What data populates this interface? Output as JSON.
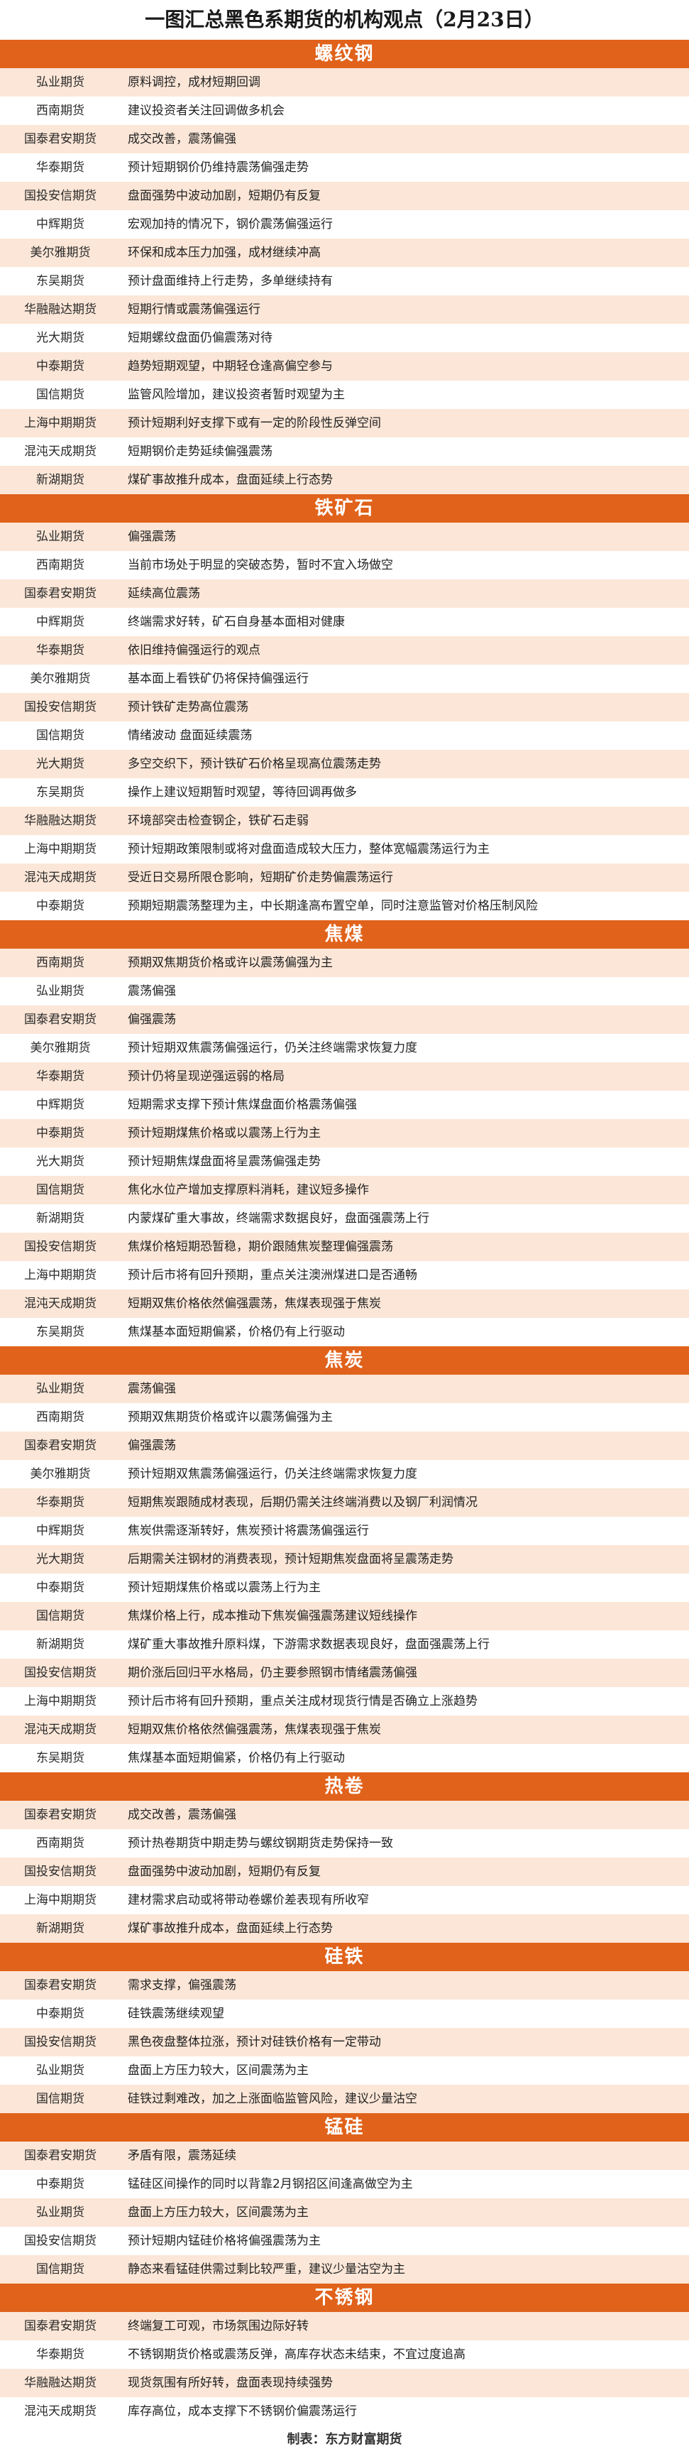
{
  "title": "一图汇总黑色系期货的机构观点（2月23日）",
  "footer": "制表：东方财富期货",
  "sections": [
    {
      "name": "螺纹钢",
      "rows": [
        [
          "弘业期货",
          "原料调控，成材短期回调"
        ],
        [
          "西南期货",
          "建议投资者关注回调做多机会"
        ],
        [
          "国泰君安期货",
          "成交改善，震荡偏强"
        ],
        [
          "华泰期货",
          "预计短期钢价仍维持震荡偏强走势"
        ],
        [
          "国投安信期货",
          "盘面强势中波动加剧，短期仍有反复"
        ],
        [
          "中辉期货",
          "宏观加持的情况下，钢价震荡偏强运行"
        ],
        [
          "美尔雅期货",
          "环保和成本压力加强，成材继续冲高"
        ],
        [
          "东吴期货",
          "预计盘面维持上行走势，多单继续持有"
        ],
        [
          "华融融达期货",
          "短期行情或震荡偏强运行"
        ],
        [
          "光大期货",
          "短期螺纹盘面仍偏震荡对待"
        ],
        [
          "中泰期货",
          "趋势短期观望，中期轻仓逢高偏空参与"
        ],
        [
          "国信期货",
          "监管风险增加，建议投资者暂时观望为主"
        ],
        [
          "上海中期期货",
          "预计短期利好支撑下或有一定的阶段性反弹空间"
        ],
        [
          "混沌天成期货",
          "短期钢价走势延续偏强震荡"
        ],
        [
          "新湖期货",
          "煤矿事故推升成本，盘面延续上行态势"
        ]
      ]
    },
    {
      "name": "铁矿石",
      "rows": [
        [
          "弘业期货",
          "偏强震荡"
        ],
        [
          "西南期货",
          "当前市场处于明显的突破态势，暂时不宜入场做空"
        ],
        [
          "国泰君安期货",
          "延续高位震荡"
        ],
        [
          "中辉期货",
          "终端需求好转，矿石自身基本面相对健康"
        ],
        [
          "华泰期货",
          "依旧维持偏强运行的观点"
        ],
        [
          "美尔雅期货",
          "基本面上看铁矿仍将保持偏强运行"
        ],
        [
          "国投安信期货",
          "预计铁矿走势高位震荡"
        ],
        [
          "国信期货",
          "情绪波动 盘面延续震荡"
        ],
        [
          "光大期货",
          "多空交织下，预计铁矿石价格呈现高位震荡走势"
        ],
        [
          "东吴期货",
          "操作上建议短期暂时观望，等待回调再做多"
        ],
        [
          "华融融达期货",
          "环境部突击检查钢企，铁矿石走弱"
        ],
        [
          "上海中期期货",
          "预计短期政策限制或将对盘面造成较大压力，整体宽幅震荡运行为主"
        ],
        [
          "混沌天成期货",
          "受近日交易所限仓影响，短期矿价走势偏震荡运行"
        ],
        [
          "中泰期货",
          "预期短期震荡整理为主，中长期逢高布置空单，同时注意监管对价格压制风险"
        ]
      ]
    },
    {
      "name": "焦煤",
      "rows": [
        [
          "西南期货",
          "预期双焦期货价格或许以震荡偏强为主"
        ],
        [
          "弘业期货",
          "震荡偏强"
        ],
        [
          "国泰君安期货",
          "偏强震荡"
        ],
        [
          "美尔雅期货",
          "预计短期双焦震荡偏强运行，仍关注终端需求恢复力度"
        ],
        [
          "华泰期货",
          "预计仍将呈现逆强运弱的格局"
        ],
        [
          "中辉期货",
          "短期需求支撑下预计焦煤盘面价格震荡偏强"
        ],
        [
          "中泰期货",
          "预计短期煤焦价格或以震荡上行为主"
        ],
        [
          "光大期货",
          "预计短期焦煤盘面将呈震荡偏强走势"
        ],
        [
          "国信期货",
          "焦化水位产增加支撑原料消耗，建议短多操作"
        ],
        [
          "新湖期货",
          "内蒙煤矿重大事故，终端需求数据良好，盘面强震荡上行"
        ],
        [
          "国投安信期货",
          "焦煤价格短期恐暂稳，期价跟随焦炭整理偏强震荡"
        ],
        [
          "上海中期期货",
          "预计后市将有回升预期，重点关注澳洲煤进口是否通畅"
        ],
        [
          "混沌天成期货",
          "短期双焦价格依然偏强震荡，焦煤表现强于焦炭"
        ],
        [
          "东吴期货",
          "焦煤基本面短期偏紧，价格仍有上行驱动"
        ]
      ]
    },
    {
      "name": "焦炭",
      "rows": [
        [
          "弘业期货",
          "震荡偏强"
        ],
        [
          "西南期货",
          "预期双焦期货价格或许以震荡偏强为主"
        ],
        [
          "国泰君安期货",
          "偏强震荡"
        ],
        [
          "美尔雅期货",
          "预计短期双焦震荡偏强运行，仍关注终端需求恢复力度"
        ],
        [
          "华泰期货",
          "短期焦炭跟随成材表现，后期仍需关注终端消费以及钢厂利润情况"
        ],
        [
          "中辉期货",
          "焦炭供需逐渐转好，焦炭预计将震荡偏强运行"
        ],
        [
          "光大期货",
          "后期需关注钢材的消费表现，预计短期焦炭盘面将呈震荡走势"
        ],
        [
          "中泰期货",
          "预计短期煤焦价格或以震荡上行为主"
        ],
        [
          "国信期货",
          "焦煤价格上行，成本推动下焦炭偏强震荡建议短线操作"
        ],
        [
          "新湖期货",
          "煤矿重大事故推升原料煤，下游需求数据表现良好，盘面强震荡上行"
        ],
        [
          "国投安信期货",
          "期价涨后回归平水格局，仍主要参照钢市情绪震荡偏强"
        ],
        [
          "上海中期期货",
          "预计后市将有回升预期，重点关注成材现货行情是否确立上涨趋势"
        ],
        [
          "混沌天成期货",
          "短期双焦价格依然偏强震荡，焦煤表现强于焦炭"
        ],
        [
          "东吴期货",
          "焦煤基本面短期偏紧，价格仍有上行驱动"
        ]
      ]
    },
    {
      "name": "热卷",
      "rows": [
        [
          "国泰君安期货",
          "成交改善，震荡偏强"
        ],
        [
          "西南期货",
          "预计热卷期货中期走势与螺纹钢期货走势保持一致"
        ],
        [
          "国投安信期货",
          "盘面强势中波动加剧，短期仍有反复"
        ],
        [
          "上海中期期货",
          "建材需求启动或将带动卷螺价差表现有所收窄"
        ],
        [
          "新湖期货",
          "煤矿事故推升成本，盘面延续上行态势"
        ]
      ]
    },
    {
      "name": "硅铁",
      "rows": [
        [
          "国泰君安期货",
          "需求支撑，偏强震荡"
        ],
        [
          "中泰期货",
          "硅铁震荡继续观望"
        ],
        [
          "国投安信期货",
          "黑色夜盘整体拉涨，预计对硅铁价格有一定带动"
        ],
        [
          "弘业期货",
          "盘面上方压力较大，区间震荡为主"
        ],
        [
          "国信期货",
          "硅铁过剩难改，加之上涨面临监管风险，建议少量沽空"
        ]
      ]
    },
    {
      "name": "锰硅",
      "rows": [
        [
          "国泰君安期货",
          "矛盾有限，震荡延续"
        ],
        [
          "中泰期货",
          "锰硅区间操作的同时以背靠2月钢招区间逢高做空为主"
        ],
        [
          "弘业期货",
          "盘面上方压力较大，区间震荡为主"
        ],
        [
          "国投安信期货",
          "预计短期内锰硅价格将偏强震荡为主"
        ],
        [
          "国信期货",
          "静态来看锰硅供需过剩比较严重，建议少量沽空为主"
        ]
      ]
    },
    {
      "name": "不锈钢",
      "rows": [
        [
          "国泰君安期货",
          "终端复工可观，市场氛围边际好转"
        ],
        [
          "华泰期货",
          "不锈钢期货价格或震荡反弹，高库存状态未结束，不宜过度追高"
        ],
        [
          "华融融达期货",
          "现货氛围有所好转，盘面表现持续强势"
        ],
        [
          "混沌天成期货",
          "库存高位，成本支撑下不锈钢价偏震荡运行"
        ]
      ]
    }
  ]
}
